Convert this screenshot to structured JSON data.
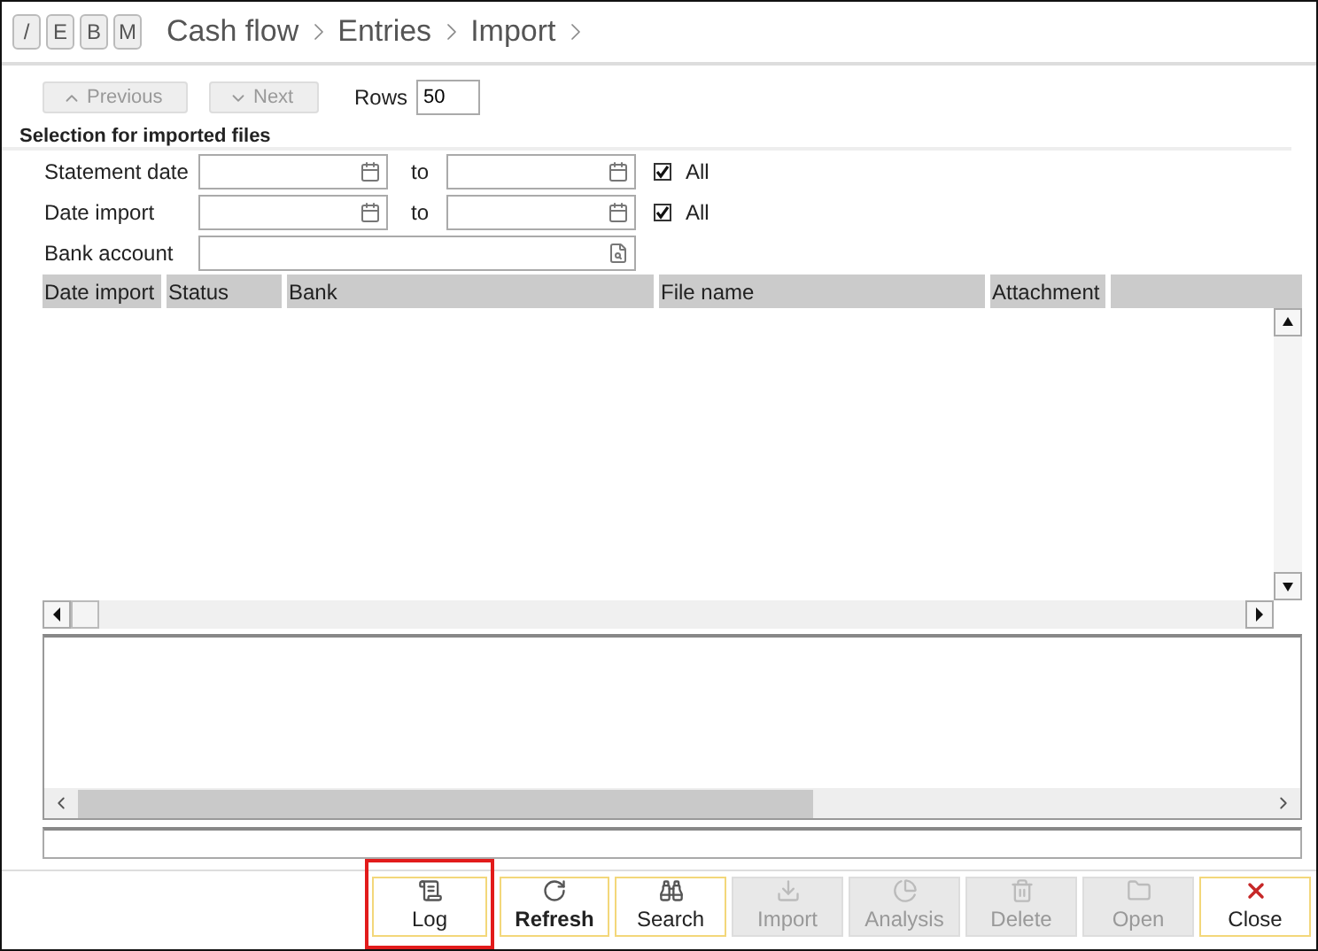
{
  "mode_buttons": [
    "/",
    "E",
    "B",
    "M"
  ],
  "breadcrumb": [
    "Cash flow",
    "Entries",
    "Import"
  ],
  "nav": {
    "previous": {
      "label": "Previous",
      "disabled": true
    },
    "next": {
      "label": "Next",
      "disabled": true
    },
    "rows_label": "Rows",
    "rows_value": "50"
  },
  "section_title": "Selection for imported files",
  "filters": [
    {
      "kind": "range",
      "label": "Statement date",
      "to_label": "to",
      "all_label": "All",
      "all_checked": true
    },
    {
      "kind": "range",
      "label": "Date import",
      "to_label": "to",
      "all_label": "All",
      "all_checked": true
    },
    {
      "kind": "lookup",
      "label": "Bank account"
    }
  ],
  "table": {
    "columns": [
      "Date import",
      "Status",
      "Bank",
      "File name",
      "Attachment"
    ]
  },
  "buttons": [
    {
      "label": "Log",
      "kind": "log",
      "disabled": false,
      "default": false,
      "highlighted": true
    },
    {
      "label": "Refresh",
      "kind": "refresh",
      "disabled": false,
      "default": true,
      "highlighted": false
    },
    {
      "label": "Search",
      "kind": "search",
      "disabled": false,
      "default": false,
      "highlighted": false
    },
    {
      "label": "Import",
      "kind": "import",
      "disabled": true,
      "default": false,
      "highlighted": false
    },
    {
      "label": "Analysis",
      "kind": "analysis",
      "disabled": true,
      "default": false,
      "highlighted": false
    },
    {
      "label": "Delete",
      "kind": "delete",
      "disabled": true,
      "default": false,
      "highlighted": false
    },
    {
      "label": "Open",
      "kind": "open",
      "disabled": true,
      "default": false,
      "highlighted": false
    },
    {
      "label": "Close",
      "kind": "close",
      "disabled": false,
      "default": false,
      "highlighted": false
    }
  ]
}
